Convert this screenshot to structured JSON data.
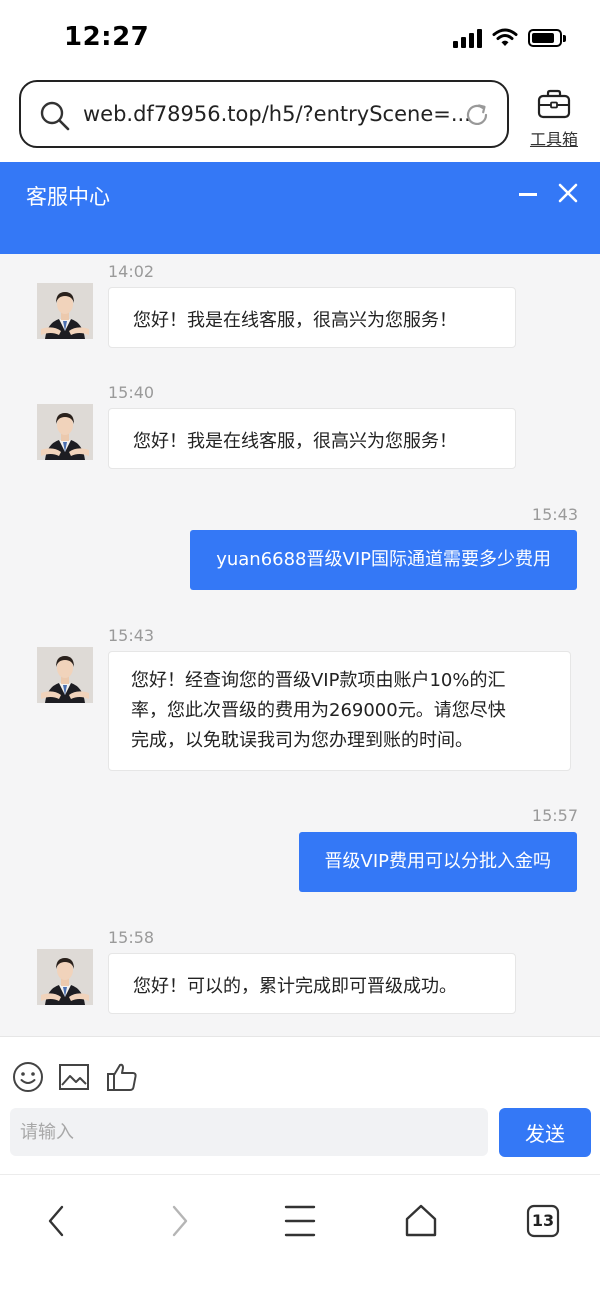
{
  "status_bar": {
    "time": "12:27"
  },
  "browser": {
    "url": "web.df78956.top/h5/?entryScene=...",
    "toolbox_label": "工具箱",
    "tabs_count": "13"
  },
  "header": {
    "title": "客服中心"
  },
  "messages": [
    {
      "side": "in",
      "time": "14:02",
      "text": "您好！我是在线客服，很高兴为您服务！"
    },
    {
      "side": "in",
      "time": "15:40",
      "text": "您好！我是在线客服，很高兴为您服务！"
    },
    {
      "side": "out",
      "time": "15:43",
      "text": "yuan6688晋级VIP国际通道需要多少费用"
    },
    {
      "side": "in",
      "time": "15:43",
      "text_lines": [
        "您好！经查询您的晋级VIP款项由账户10%的汇",
        "率，您此次晋级的费用为269000元。请您尽快",
        "完成，以免耽误我司为您办理到账的时间。"
      ]
    },
    {
      "side": "out",
      "time": "15:57",
      "text": "晋级VIP费用可以分批入金吗"
    },
    {
      "side": "in",
      "time": "15:58",
      "text": "您好！可以的，累计完成即可晋级成功。"
    }
  ],
  "composer": {
    "placeholder": "请输入",
    "send_label": "发送"
  },
  "icons": [
    "search-icon",
    "reload-icon",
    "toolbox-icon",
    "minimize-icon",
    "close-icon",
    "emoji-icon",
    "image-icon",
    "like-icon",
    "back-icon",
    "forward-icon",
    "menu-icon",
    "home-icon",
    "tabs-icon"
  ],
  "colors": {
    "accent": "#3478f6",
    "chat_bg": "#f5f5f6",
    "timestamp": "#9a9a9a"
  }
}
